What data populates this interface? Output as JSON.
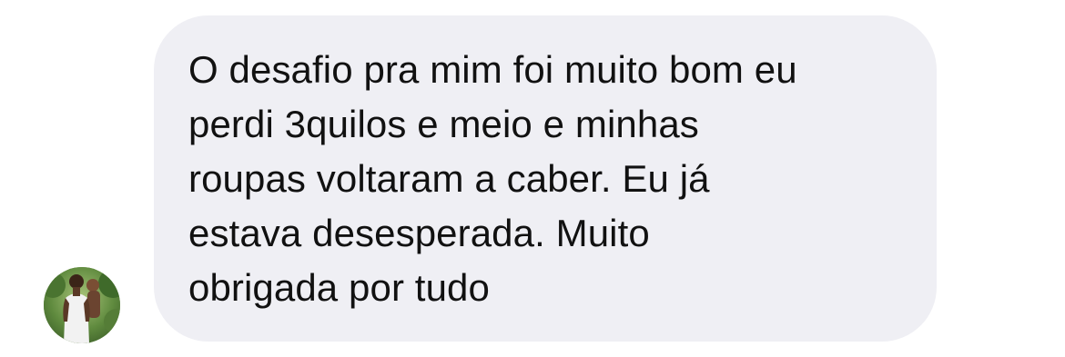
{
  "message": {
    "lines": [
      "O desafio pra mim foi muito bom eu",
      "perdi 3quilos e meio e minhas",
      "roupas voltaram a caber. Eu já",
      "estava desesperada. Muito",
      "obrigada por tudo"
    ]
  },
  "avatar": {
    "icon": "user-photo"
  },
  "colors": {
    "bubble_background": "#efeff4",
    "text": "#111111"
  }
}
